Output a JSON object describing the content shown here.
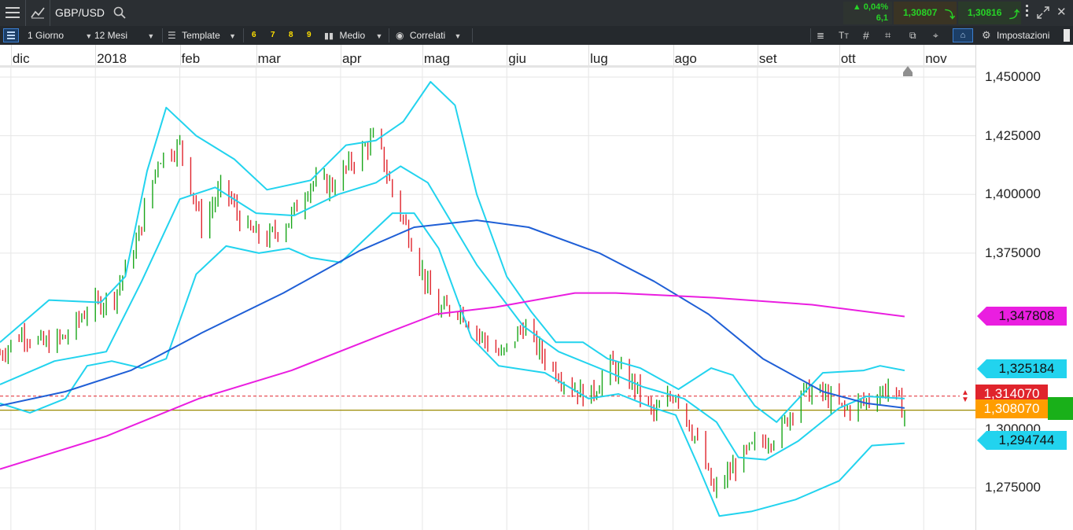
{
  "topbar": {
    "symbol": "GBP/USD",
    "change_pct": "0,04%",
    "change_abs": "6,1",
    "bid": "1,30807",
    "ask": "1,30816"
  },
  "toolbar": {
    "timeframe": "1 Giorno",
    "range": "12 Mesi",
    "template": "Template",
    "hotkeys": [
      "6",
      "7",
      "8",
      "9"
    ],
    "indicator": "Medio",
    "correlated": "Correlati",
    "settings": "Impostazioni"
  },
  "colors": {
    "bullish": "#19a619",
    "bearish": "#e0242c",
    "bollinger": "#22d3ee",
    "ma_fast": "#1f5fd6",
    "ma_slow": "#ea1ee0",
    "price_line": "#9a8a00",
    "dashed": "#e0242c"
  },
  "chart_data": {
    "type": "candlestick",
    "symbol": "GBP/USD",
    "timeframe": "1 Giorno",
    "x_labels": [
      "dic",
      "2018",
      "feb",
      "mar",
      "apr",
      "mag",
      "giu",
      "lug",
      "ago",
      "set",
      "ott",
      "nov"
    ],
    "x_range": [
      "2017-11-27",
      "2018-11-20"
    ],
    "y_ticks": [
      "1,450000",
      "1,425000",
      "1,400000",
      "1,375000",
      "1,300000",
      "1,275000"
    ],
    "y_range": [
      1.258,
      1.458
    ],
    "grid": true,
    "price_labels": [
      {
        "name": "ma_slow_last",
        "value": "1,347808",
        "color": "#ea1ee0"
      },
      {
        "name": "bollinger_upper_last",
        "value": "1,325184",
        "color": "#22d3ee"
      },
      {
        "name": "dashed_level",
        "value": "1,314070",
        "color": "#e0242c"
      },
      {
        "name": "current_price",
        "value": "1,308070",
        "color": "#ff9d00"
      },
      {
        "name": "bollinger_lower_last",
        "value": "1,294744",
        "color": "#22d3ee"
      }
    ],
    "dashed_level": 1.31407,
    "current_price": 1.30807,
    "close_series": [
      [
        "2017-11-27",
        1.332
      ],
      [
        "2017-12-05",
        1.341
      ],
      [
        "2017-12-13",
        1.336
      ],
      [
        "2017-12-21",
        1.339
      ],
      [
        "2017-12-29",
        1.351
      ],
      [
        "2018-01-08",
        1.357
      ],
      [
        "2018-01-16",
        1.379
      ],
      [
        "2018-01-24",
        1.415
      ],
      [
        "2018-02-01",
        1.421
      ],
      [
        "2018-02-09",
        1.387
      ],
      [
        "2018-02-17",
        1.404
      ],
      [
        "2018-02-25",
        1.385
      ],
      [
        "2018-03-05",
        1.381
      ],
      [
        "2018-03-13",
        1.389
      ],
      [
        "2018-03-21",
        1.405
      ],
      [
        "2018-03-29",
        1.404
      ],
      [
        "2018-04-06",
        1.415
      ],
      [
        "2018-04-14",
        1.425
      ],
      [
        "2018-04-20",
        1.401
      ],
      [
        "2018-04-28",
        1.377
      ],
      [
        "2018-05-06",
        1.35
      ],
      [
        "2018-05-14",
        1.352
      ],
      [
        "2018-05-22",
        1.34
      ],
      [
        "2018-05-30",
        1.331
      ],
      [
        "2018-06-07",
        1.344
      ],
      [
        "2018-06-15",
        1.33
      ],
      [
        "2018-06-23",
        1.32
      ],
      [
        "2018-07-01",
        1.313
      ],
      [
        "2018-07-09",
        1.327
      ],
      [
        "2018-07-17",
        1.32
      ],
      [
        "2018-07-25",
        1.306
      ],
      [
        "2018-08-02",
        1.316
      ],
      [
        "2018-08-10",
        1.294
      ],
      [
        "2018-08-16",
        1.273
      ],
      [
        "2018-08-24",
        1.285
      ],
      [
        "2018-09-01",
        1.294
      ],
      [
        "2018-09-09",
        1.298
      ],
      [
        "2018-09-17",
        1.316
      ],
      [
        "2018-09-25",
        1.315
      ],
      [
        "2018-10-03",
        1.308
      ],
      [
        "2018-10-11",
        1.312
      ],
      [
        "2018-10-19",
        1.318
      ],
      [
        "2018-10-25",
        1.307
      ]
    ],
    "series": [
      {
        "name": "bollinger_upper",
        "color": "#22d3ee",
        "points": [
          [
            "2017-11-27",
            1.337
          ],
          [
            "2017-12-15",
            1.355
          ],
          [
            "2018-01-03",
            1.354
          ],
          [
            "2018-01-12",
            1.365
          ],
          [
            "2018-01-20",
            1.41
          ],
          [
            "2018-01-27",
            1.437
          ],
          [
            "2018-02-07",
            1.425
          ],
          [
            "2018-02-21",
            1.415
          ],
          [
            "2018-03-05",
            1.402
          ],
          [
            "2018-03-21",
            1.406
          ],
          [
            "2018-04-03",
            1.421
          ],
          [
            "2018-04-14",
            1.423
          ],
          [
            "2018-04-24",
            1.431
          ],
          [
            "2018-05-04",
            1.448
          ],
          [
            "2018-05-13",
            1.438
          ],
          [
            "2018-05-21",
            1.4
          ],
          [
            "2018-06-01",
            1.365
          ],
          [
            "2018-06-10",
            1.35
          ],
          [
            "2018-06-19",
            1.337
          ],
          [
            "2018-06-29",
            1.337
          ],
          [
            "2018-07-08",
            1.33
          ],
          [
            "2018-07-20",
            1.326
          ],
          [
            "2018-08-03",
            1.317
          ],
          [
            "2018-08-15",
            1.326
          ],
          [
            "2018-08-23",
            1.323
          ],
          [
            "2018-08-31",
            1.31
          ],
          [
            "2018-09-08",
            1.303
          ],
          [
            "2018-09-16",
            1.313
          ],
          [
            "2018-09-25",
            1.324
          ],
          [
            "2018-10-10",
            1.325
          ],
          [
            "2018-10-16",
            1.327
          ],
          [
            "2018-10-25",
            1.325
          ]
        ]
      },
      {
        "name": "bollinger_mid",
        "color": "#22d3ee",
        "points": [
          [
            "2017-11-27",
            1.319
          ],
          [
            "2017-12-17",
            1.329
          ],
          [
            "2018-01-05",
            1.333
          ],
          [
            "2018-01-18",
            1.363
          ],
          [
            "2018-02-01",
            1.398
          ],
          [
            "2018-02-14",
            1.403
          ],
          [
            "2018-03-01",
            1.392
          ],
          [
            "2018-03-15",
            1.391
          ],
          [
            "2018-03-31",
            1.4
          ],
          [
            "2018-04-14",
            1.405
          ],
          [
            "2018-04-23",
            1.412
          ],
          [
            "2018-05-03",
            1.405
          ],
          [
            "2018-05-21",
            1.37
          ],
          [
            "2018-06-07",
            1.344
          ],
          [
            "2018-06-20",
            1.333
          ],
          [
            "2018-07-07",
            1.325
          ],
          [
            "2018-07-21",
            1.318
          ],
          [
            "2018-08-05",
            1.313
          ],
          [
            "2018-08-17",
            1.303
          ],
          [
            "2018-08-25",
            1.288
          ],
          [
            "2018-09-04",
            1.287
          ],
          [
            "2018-09-16",
            1.295
          ],
          [
            "2018-10-01",
            1.309
          ],
          [
            "2018-10-11",
            1.314
          ],
          [
            "2018-10-25",
            1.313
          ]
        ]
      },
      {
        "name": "bollinger_lower",
        "color": "#22d3ee",
        "points": [
          [
            "2017-11-27",
            1.311
          ],
          [
            "2017-12-08",
            1.307
          ],
          [
            "2017-12-21",
            1.313
          ],
          [
            "2017-12-29",
            1.327
          ],
          [
            "2018-01-07",
            1.329
          ],
          [
            "2018-01-18",
            1.326
          ],
          [
            "2018-01-27",
            1.33
          ],
          [
            "2018-02-07",
            1.366
          ],
          [
            "2018-02-18",
            1.378
          ],
          [
            "2018-03-02",
            1.375
          ],
          [
            "2018-03-13",
            1.377
          ],
          [
            "2018-03-21",
            1.373
          ],
          [
            "2018-04-01",
            1.371
          ],
          [
            "2018-04-09",
            1.38
          ],
          [
            "2018-04-20",
            1.392
          ],
          [
            "2018-04-28",
            1.392
          ],
          [
            "2018-05-07",
            1.377
          ],
          [
            "2018-05-19",
            1.339
          ],
          [
            "2018-05-29",
            1.327
          ],
          [
            "2018-06-15",
            1.324
          ],
          [
            "2018-07-01",
            1.313
          ],
          [
            "2018-07-12",
            1.315
          ],
          [
            "2018-07-25",
            1.309
          ],
          [
            "2018-08-02",
            1.306
          ],
          [
            "2018-08-10",
            1.285
          ],
          [
            "2018-08-18",
            1.263
          ],
          [
            "2018-08-30",
            1.265
          ],
          [
            "2018-09-15",
            1.27
          ],
          [
            "2018-10-01",
            1.278
          ],
          [
            "2018-10-13",
            1.293
          ],
          [
            "2018-10-25",
            1.294
          ]
        ]
      },
      {
        "name": "ma_fast",
        "color": "#1f5fd6",
        "points": [
          [
            "2017-11-27",
            1.31
          ],
          [
            "2017-12-21",
            1.316
          ],
          [
            "2018-01-14",
            1.325
          ],
          [
            "2018-02-09",
            1.341
          ],
          [
            "2018-03-11",
            1.358
          ],
          [
            "2018-04-08",
            1.376
          ],
          [
            "2018-04-28",
            1.386
          ],
          [
            "2018-05-21",
            1.389
          ],
          [
            "2018-06-09",
            1.386
          ],
          [
            "2018-07-05",
            1.375
          ],
          [
            "2018-07-25",
            1.363
          ],
          [
            "2018-08-14",
            1.349
          ],
          [
            "2018-09-03",
            1.33
          ],
          [
            "2018-09-25",
            1.316
          ],
          [
            "2018-10-11",
            1.311
          ],
          [
            "2018-10-25",
            1.309
          ]
        ]
      },
      {
        "name": "ma_slow",
        "color": "#ea1ee0",
        "points": [
          [
            "2017-11-27",
            1.283
          ],
          [
            "2018-01-05",
            1.297
          ],
          [
            "2018-02-08",
            1.313
          ],
          [
            "2018-03-14",
            1.325
          ],
          [
            "2018-04-18",
            1.341
          ],
          [
            "2018-05-06",
            1.349
          ],
          [
            "2018-05-28",
            1.352
          ],
          [
            "2018-06-26",
            1.358
          ],
          [
            "2018-07-11",
            1.358
          ],
          [
            "2018-08-16",
            1.356
          ],
          [
            "2018-09-21",
            1.353
          ],
          [
            "2018-10-25",
            1.348
          ]
        ]
      }
    ]
  }
}
